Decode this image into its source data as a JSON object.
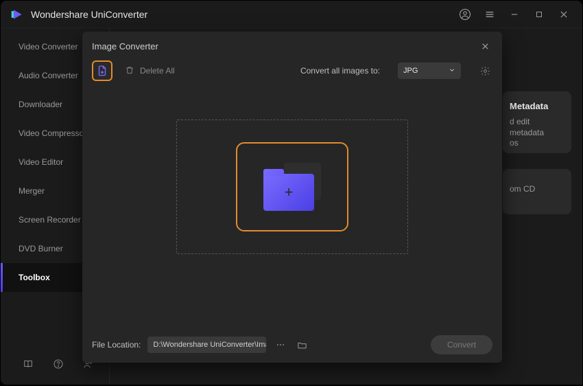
{
  "app": {
    "title": "Wondershare UniConverter"
  },
  "sidebar": {
    "items": [
      {
        "label": "Video Converter"
      },
      {
        "label": "Audio Converter"
      },
      {
        "label": "Downloader"
      },
      {
        "label": "Video Compressor"
      },
      {
        "label": "Video Editor"
      },
      {
        "label": "Merger"
      },
      {
        "label": "Screen Recorder"
      },
      {
        "label": "DVD Burner"
      },
      {
        "label": "Toolbox"
      }
    ],
    "activeIndex": 8
  },
  "behind": {
    "card1_title": "Metadata",
    "card1_sub1": "d edit metadata",
    "card1_sub2": "os",
    "card2_sub": "om CD"
  },
  "modal": {
    "title": "Image Converter",
    "delete_all": "Delete All",
    "convert_label": "Convert all images to:",
    "format_value": "JPG",
    "file_location_label": "File Location:",
    "file_location_value": "D:\\Wondershare UniConverter\\Image Output",
    "convert_button": "Convert"
  },
  "icons": {
    "plus": "+"
  }
}
